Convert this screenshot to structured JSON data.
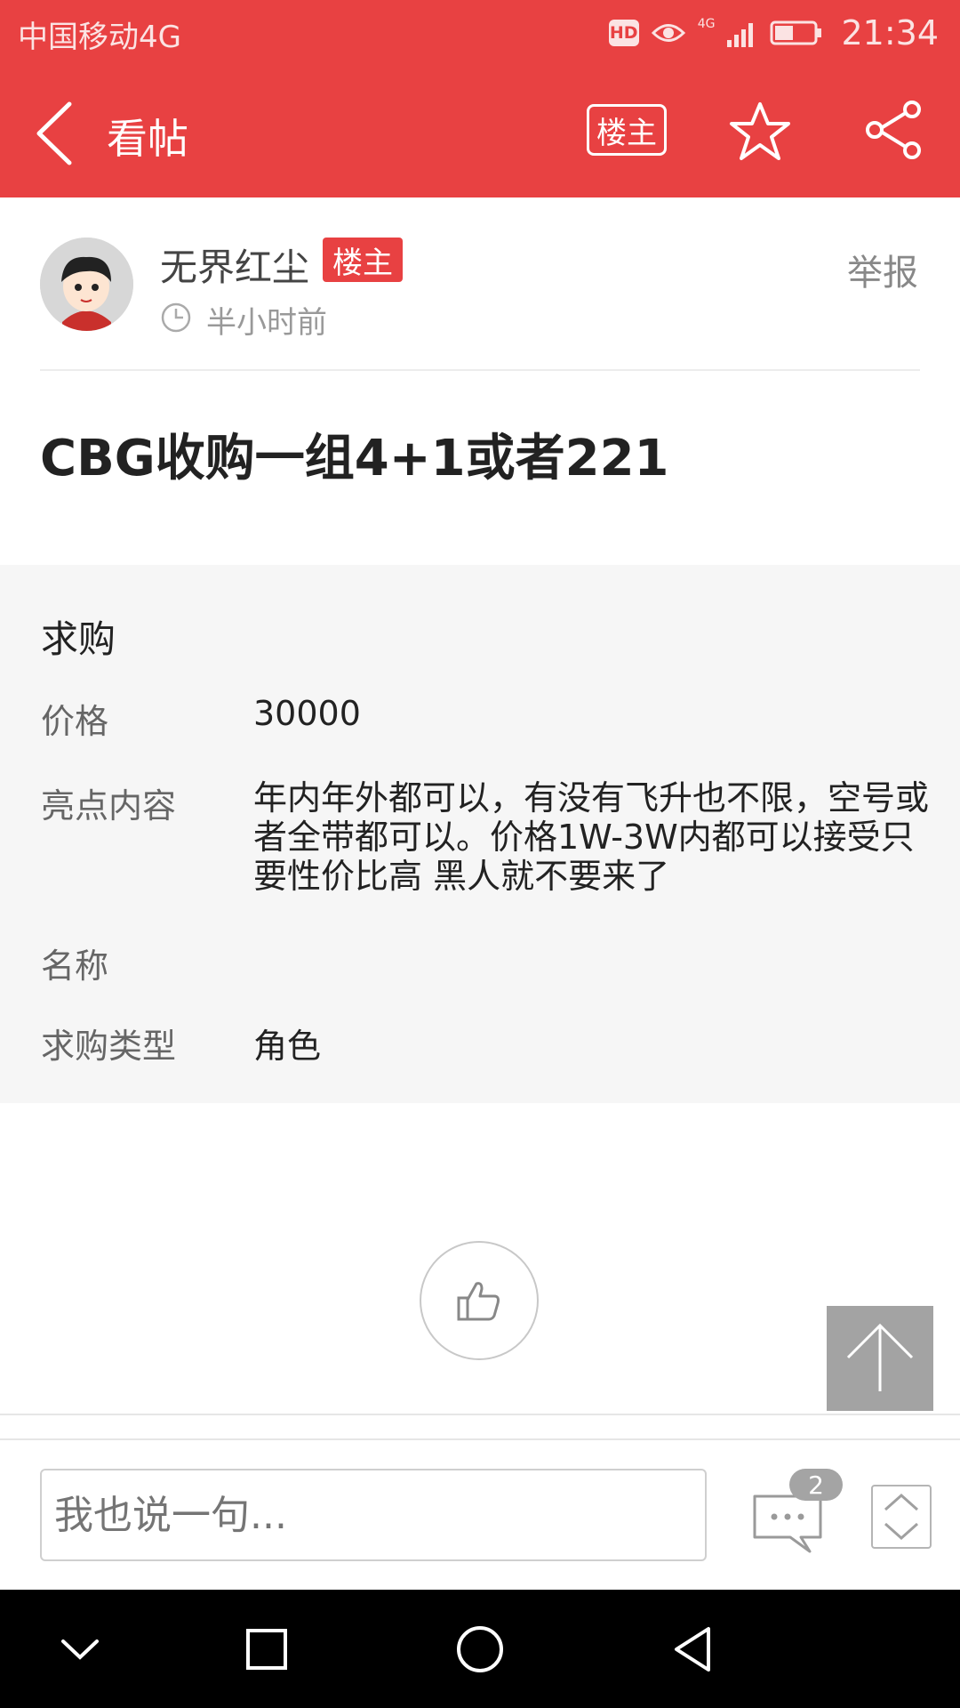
{
  "status_bar": {
    "carrier": "中国移动4G",
    "hd": "HD",
    "network": "4G",
    "time": "21:34"
  },
  "nav": {
    "title": "看帖",
    "owner_button": "楼主",
    "icons": [
      "back-arrow-icon",
      "star-icon",
      "share-icon"
    ]
  },
  "author": {
    "name": "无界红尘",
    "tag": "楼主",
    "time": "半小时前",
    "report": "举报"
  },
  "post": {
    "title": "CBG收购一组4+1或者221"
  },
  "details": {
    "heading": "求购",
    "rows": [
      {
        "label": "价格",
        "value": "30000"
      },
      {
        "label": "亮点内容",
        "value": "年内年外都可以，有没有飞升也不限，空号或者全带都可以。价格1W-3W内都可以接受只要性价比高 黑人就不要来了"
      },
      {
        "label": "名称",
        "value": ""
      },
      {
        "label": "求购类型",
        "value": "角色"
      }
    ]
  },
  "comment_bar": {
    "placeholder": "我也说一句...",
    "comment_count": "2"
  },
  "colors": {
    "brand_red": "#e84142",
    "detail_bg": "#f6f6f6"
  }
}
